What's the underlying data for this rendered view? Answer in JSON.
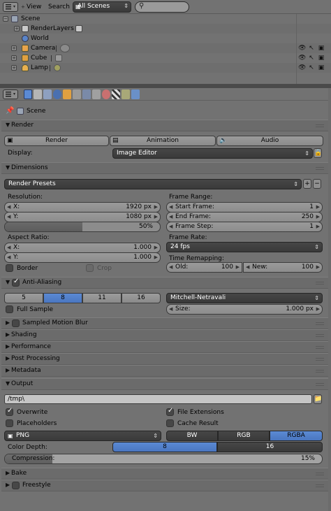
{
  "outliner": {
    "menu_view": "View",
    "menu_search": "Search",
    "scene_select": "All Scenes",
    "search_placeholder": "",
    "items": [
      {
        "label": "Scene"
      },
      {
        "label": "RenderLayers"
      },
      {
        "label": "World"
      },
      {
        "label": "Camera"
      },
      {
        "label": "Cube"
      },
      {
        "label": "Lamp"
      }
    ]
  },
  "props": {
    "breadcrumb": "Scene",
    "render": {
      "title": "Render",
      "btn_render": "Render",
      "btn_animation": "Animation",
      "btn_audio": "Audio",
      "display_label": "Display:",
      "display_value": "Image Editor"
    },
    "dimensions": {
      "title": "Dimensions",
      "presets": "Render Presets",
      "resolution_label": "Resolution:",
      "res_x_label": "X:",
      "res_x_value": "1920 px",
      "res_y_label": "Y:",
      "res_y_value": "1080 px",
      "res_pct_value": "50%",
      "frame_range_label": "Frame Range:",
      "start_label": "Start Frame:",
      "start_value": "1",
      "end_label": "End Frame:",
      "end_value": "250",
      "step_label": "Frame Step:",
      "step_value": "1",
      "aspect_label": "Aspect Ratio:",
      "asp_x_label": "X:",
      "asp_x_value": "1.000",
      "asp_y_label": "Y:",
      "asp_y_value": "1.000",
      "frame_rate_label": "Frame Rate:",
      "frame_rate_value": "24 fps",
      "border_label": "Border",
      "crop_label": "Crop",
      "time_remap_label": "Time Remapping:",
      "old_label": "Old:",
      "old_value": "100",
      "new_label": "New:",
      "new_value": "100"
    },
    "antialiasing": {
      "title": "Anti-Aliasing",
      "samples": [
        "5",
        "8",
        "11",
        "16"
      ],
      "filter_value": "Mitchell-Netravali",
      "full_sample_label": "Full Sample",
      "size_label": "Size:",
      "size_value": "1.000 px"
    },
    "collapsed_panels": {
      "motion_blur": "Sampled Motion Blur",
      "shading": "Shading",
      "performance": "Performance",
      "post_processing": "Post Processing",
      "metadata": "Metadata"
    },
    "output": {
      "title": "Output",
      "path": "/tmp\\",
      "overwrite_label": "Overwrite",
      "file_ext_label": "File Extensions",
      "placeholders_label": "Placeholders",
      "cache_label": "Cache Result",
      "format_value": "PNG",
      "color_modes": [
        "BW",
        "RGB",
        "RGBA"
      ],
      "depth_label": "Color Depth:",
      "depths": [
        "8",
        "16"
      ],
      "compression_label": "Compression:",
      "compression_value": "15%",
      "compression_fraction": 0.15
    },
    "bake_title": "Bake",
    "freestyle_title": "Freestyle"
  },
  "colors": {
    "selected_blue": "#5b8ad4",
    "dark_field": "#3e3e3e",
    "panel_bg": "#727272"
  }
}
